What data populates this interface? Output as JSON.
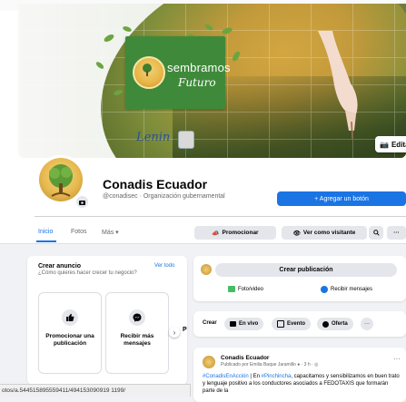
{
  "cover": {
    "logo_line1": "sembramos",
    "logo_line2": "Futuro",
    "signature": "Lenin",
    "edit_label": "Editar"
  },
  "profile": {
    "name": "Conadis Ecuador",
    "subtitle": "@conadisec · Organización gubernamental",
    "add_button_label": "+ Agregar un botón"
  },
  "tabs": [
    {
      "label": "Inicio",
      "active": true
    },
    {
      "label": "Fotos",
      "active": false
    },
    {
      "label": "Más ▾",
      "active": false
    }
  ],
  "actions": {
    "promote": "Promocionar",
    "view_as": "Ver como visitante",
    "search_icon": "search-icon",
    "more": "···"
  },
  "ads": {
    "title": "Crear anuncio",
    "subtitle": "¿Cómo quieres hacer crecer tu negocio?",
    "see_all": "Ver todo",
    "cards": [
      {
        "label": "Promocionar una publicación",
        "icon": "thumbs-up-icon"
      },
      {
        "label": "Recibir más mensajes",
        "icon": "messenger-icon"
      }
    ],
    "next_card_prefix": "Pr"
  },
  "create_post": {
    "button": "Crear publicación",
    "photo_video": "Foto/video",
    "messages": "Recibir mensajes"
  },
  "create_bar": {
    "label": "Crear",
    "live": "En vivo",
    "event": "Evento",
    "offer": "Oferta",
    "more": "···"
  },
  "post": {
    "author": "Conadis Ecuador",
    "meta": "Publicado por Emilia Baque Jaramillo ● · 3 h · ◎",
    "hashtag1": "#ConadisEnAcción",
    "text1": " | En ",
    "hashtag2": "#Pinchincha",
    "text2": ", capacitamos y sensibilizamos en buen trato y lenguaje positivo a los conductores asociados a FEDOTAXIS que formarán parte de la",
    "dots": "···"
  },
  "statusbar": {
    "url": "otos/a.544515895559411/494153090919 1199/"
  }
}
